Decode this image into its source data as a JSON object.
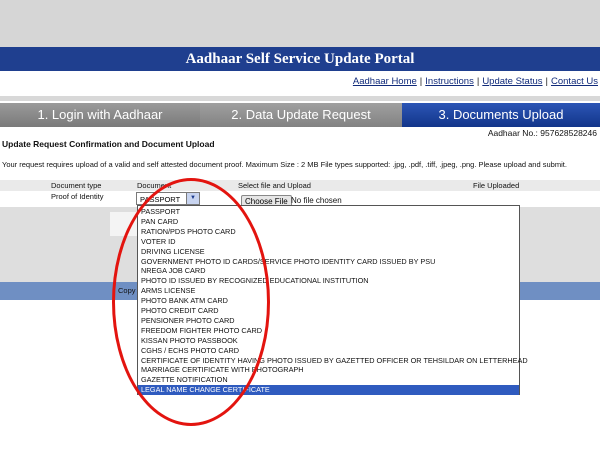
{
  "header": {
    "title": "Aadhaar Self Service Update Portal",
    "links": [
      "Aadhaar Home",
      "Instructions",
      "Update Status",
      "Contact Us"
    ],
    "separator": "|"
  },
  "steps": [
    {
      "label": "1. Login with Aadhaar"
    },
    {
      "label": "2. Data Update Request"
    },
    {
      "label": "3. Documents Upload"
    }
  ],
  "aadhaar_no": "Aadhaar No.: 957628528246",
  "section_title": "Update Request Confirmation and Document Upload",
  "instructions": "Your request requires upload of a valid and self attested document proof. Maximum Size : 2 MB File types supported: .jpg, .pdf, .tiff, .jpeg, .png. Please upload and submit.",
  "table": {
    "headers": [
      "Document type",
      "Document",
      "Select file and Upload",
      "File Uploaded"
    ],
    "row": {
      "doc_type": "Proof of Identity",
      "selected_document": "PASSPORT",
      "choose_file_label": "Choose File",
      "file_status": "No file chosen"
    }
  },
  "footer": {
    "copy_text": "Copy"
  },
  "dropdown": {
    "highlighted_index": 18,
    "options": [
      "PASSPORT",
      "PAN CARD",
      "RATION/PDS PHOTO CARD",
      "VOTER ID",
      "DRIVING LICENSE",
      "GOVERNMENT PHOTO ID CARDS/SERVICE PHOTO IDENTITY CARD ISSUED BY PSU",
      "NREGA JOB CARD",
      "PHOTO ID ISSUED BY RECOGNIZED EDUCATIONAL INSTITUTION",
      "ARMS LICENSE",
      "PHOTO BANK ATM CARD",
      "PHOTO CREDIT CARD",
      "PENSIONER PHOTO CARD",
      "FREEDOM FIGHTER PHOTO CARD",
      "KISSAN PHOTO PASSBOOK",
      "CGHS / ECHS PHOTO CARD",
      "CERTIFICATE OF IDENTITY HAVING PHOTO ISSUED BY GAZETTED OFFICER OR TEHSILDAR ON LETTERHEAD",
      "MARRIAGE CERTIFICATE WITH PHOTOGRAPH",
      "GAZETTE NOTIFICATION",
      "LEGAL NAME CHANGE CERTIFICATE"
    ]
  },
  "icons": {
    "select_arrow": "chevron-down-icon"
  },
  "colors": {
    "title_bar": "#1f3f8f",
    "active_step": "#12358a",
    "highlight": "#2f5bbf",
    "annotation": "#e3140f"
  }
}
